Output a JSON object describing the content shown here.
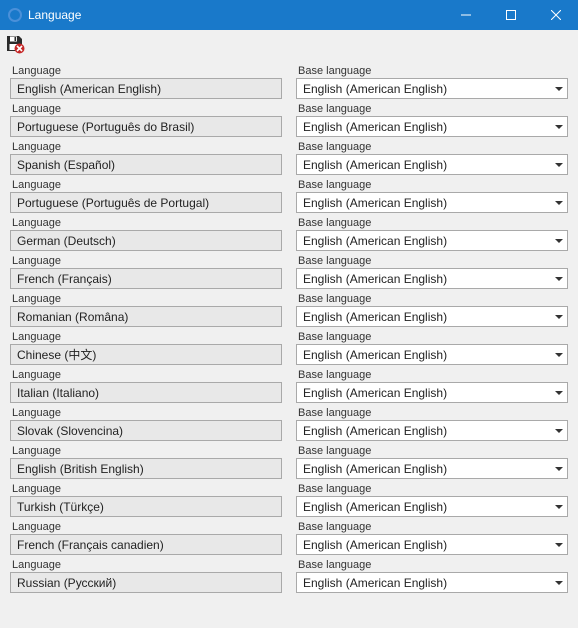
{
  "window": {
    "title": "Language"
  },
  "labels": {
    "language": "Language",
    "base_language": "Base language"
  },
  "base_language_value": "English (American English)",
  "rows": [
    {
      "language": "English (American English)"
    },
    {
      "language": "Portuguese (Português do Brasil)"
    },
    {
      "language": "Spanish (Español)"
    },
    {
      "language": "Portuguese (Português de Portugal)"
    },
    {
      "language": "German (Deutsch)"
    },
    {
      "language": "French (Français)"
    },
    {
      "language": "Romanian (Româna)"
    },
    {
      "language": "Chinese (中文)"
    },
    {
      "language": "Italian (Italiano)"
    },
    {
      "language": "Slovak (Slovencina)"
    },
    {
      "language": "English (British English)"
    },
    {
      "language": "Turkish (Türkçe)"
    },
    {
      "language": "French (Français canadien)"
    },
    {
      "language": "Russian (Русский)"
    }
  ]
}
